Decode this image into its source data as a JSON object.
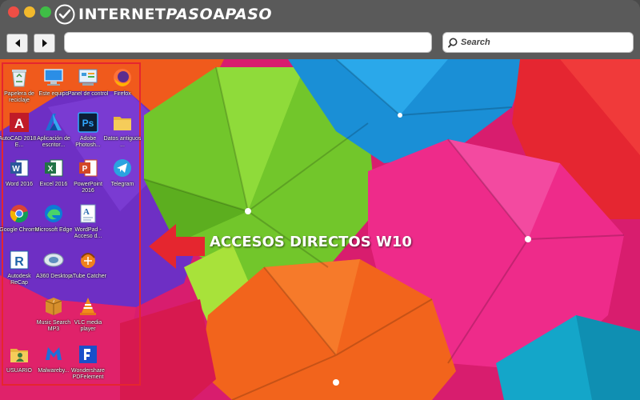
{
  "brand": {
    "prefix": "INTERNET",
    "accent": "PASO",
    "mid": "A",
    "suffix": "PASO"
  },
  "toolbar": {
    "address_value": "",
    "search_placeholder": "Search"
  },
  "desktop": {
    "icons": [
      {
        "label": "Papelera de reciclaje",
        "icon": "recycle-bin-icon"
      },
      {
        "label": "Este equipo",
        "icon": "this-pc-icon"
      },
      {
        "label": "Panel de control",
        "icon": "control-panel-icon"
      },
      {
        "label": "Firefox",
        "icon": "firefox-icon"
      },
      {
        "label": "AutoCAD 2018 - E...",
        "icon": "autocad-icon"
      },
      {
        "label": "Aplicación de escritor...",
        "icon": "azure-app-icon"
      },
      {
        "label": "Adobe Photosh...",
        "icon": "photoshop-icon"
      },
      {
        "label": "Datos antiguos ...",
        "icon": "folder-icon"
      },
      {
        "label": "Word 2016",
        "icon": "word-icon"
      },
      {
        "label": "Excel 2016",
        "icon": "excel-icon"
      },
      {
        "label": "PowerPoint 2016",
        "icon": "powerpoint-icon"
      },
      {
        "label": "Telegram",
        "icon": "telegram-icon"
      },
      {
        "label": "Google Chrome",
        "icon": "chrome-icon"
      },
      {
        "label": "Microsoft Edge",
        "icon": "edge-icon"
      },
      {
        "label": "WordPad - Acceso d...",
        "icon": "wordpad-icon"
      },
      {
        "label": "Autodesk ReCap",
        "icon": "recap-icon"
      },
      {
        "label": "A360 Desktop",
        "icon": "a360-icon"
      },
      {
        "label": "aTube Catcher",
        "icon": "atube-icon"
      },
      {
        "label": "Music Search MP3",
        "icon": "music-search-icon"
      },
      {
        "label": "VLC media player",
        "icon": "vlc-icon"
      },
      {
        "label": "USUARIO",
        "icon": "user-folder-icon"
      },
      {
        "label": "Malwareby...",
        "icon": "malwarebytes-icon"
      },
      {
        "label": "Wondershare PDFelement",
        "icon": "pdfelement-icon"
      }
    ],
    "callout": "ACCESOS DIRECTOS W10"
  },
  "colors": {
    "highlight": "#e5262f",
    "titlebar": "#5a5a5a"
  }
}
